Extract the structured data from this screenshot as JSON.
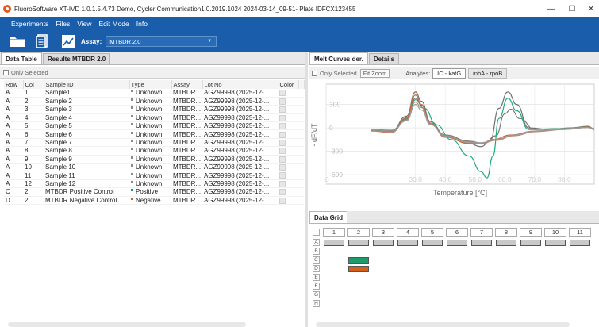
{
  "window": {
    "title": "FluoroSoftware XT-IVD 1.0.1.5.4.73 Demo, Cycler Communication1.0.2019.1024   2024-03-14_09-51- Plate IDFCX123455",
    "minimize": "—",
    "maximize": "☐",
    "close": "✕"
  },
  "menu": {
    "items": [
      "Experiments",
      "Files",
      "View",
      "Edit Mode",
      "Info"
    ]
  },
  "toolbar": {
    "assay_label": "Assay:",
    "assay_value": "MTBDR 2.0"
  },
  "left_panel": {
    "tabs": [
      "Data Table",
      "Results MTBDR 2.0"
    ],
    "only_selected": "Only Selected",
    "columns": [
      "Row",
      "Col",
      "Sample ID",
      "Type",
      "Assay",
      "Lot No",
      "Color",
      "I"
    ],
    "rows": [
      {
        "row": "A",
        "col": "1",
        "sample": "Sample1",
        "type": "Unknown",
        "assay": "MTBDR...",
        "lot": "AGZ99998  (2025-12-...",
        "marker": "#8a8a8a"
      },
      {
        "row": "A",
        "col": "2",
        "sample": "Sample 2",
        "type": "Unknown",
        "assay": "MTBDR...",
        "lot": "AGZ99998  (2025-12-...",
        "marker": "#8a8a8a"
      },
      {
        "row": "A",
        "col": "3",
        "sample": "Sample 3",
        "type": "Unknown",
        "assay": "MTBDR...",
        "lot": "AGZ99998  (2025-12-...",
        "marker": "#8a8a8a"
      },
      {
        "row": "A",
        "col": "4",
        "sample": "Sample 4",
        "type": "Unknown",
        "assay": "MTBDR...",
        "lot": "AGZ99998  (2025-12-...",
        "marker": "#8a8a8a"
      },
      {
        "row": "A",
        "col": "5",
        "sample": "Sample 5",
        "type": "Unknown",
        "assay": "MTBDR...",
        "lot": "AGZ99998  (2025-12-...",
        "marker": "#8a8a8a"
      },
      {
        "row": "A",
        "col": "6",
        "sample": "Sample 6",
        "type": "Unknown",
        "assay": "MTBDR...",
        "lot": "AGZ99998  (2025-12-...",
        "marker": "#8a8a8a"
      },
      {
        "row": "A",
        "col": "7",
        "sample": "Sample 7",
        "type": "Unknown",
        "assay": "MTBDR...",
        "lot": "AGZ99998  (2025-12-...",
        "marker": "#8a8a8a"
      },
      {
        "row": "A",
        "col": "8",
        "sample": "Sample 8",
        "type": "Unknown",
        "assay": "MTBDR...",
        "lot": "AGZ99998  (2025-12-...",
        "marker": "#8a8a8a"
      },
      {
        "row": "A",
        "col": "9",
        "sample": "Sample 9",
        "type": "Unknown",
        "assay": "MTBDR...",
        "lot": "AGZ99998  (2025-12-...",
        "marker": "#8a8a8a"
      },
      {
        "row": "A",
        "col": "10",
        "sample": "Sample 10",
        "type": "Unknown",
        "assay": "MTBDR...",
        "lot": "AGZ99998  (2025-12-...",
        "marker": "#8a8a8a"
      },
      {
        "row": "A",
        "col": "11",
        "sample": "Sample 11",
        "type": "Unknown",
        "assay": "MTBDR...",
        "lot": "AGZ99998  (2025-12-...",
        "marker": "#8a8a8a"
      },
      {
        "row": "A",
        "col": "12",
        "sample": "Sample 12",
        "type": "Unknown",
        "assay": "MTBDR...",
        "lot": "AGZ99998  (2025-12-...",
        "marker": "#8a8a8a"
      },
      {
        "row": "C",
        "col": "2",
        "sample": "MTBDR Positive Control",
        "type": "Positive",
        "assay": "MTBDR...",
        "lot": "AGZ99998  (2025-12-...",
        "marker": "#1f9a5a"
      },
      {
        "row": "D",
        "col": "2",
        "sample": "MTBDR Negative Control",
        "type": "Negative",
        "assay": "MTBDR...",
        "lot": "AGZ99998  (2025-12-...",
        "marker": "#d2601a"
      }
    ]
  },
  "right_panel": {
    "tabs": [
      "Melt Curves der.",
      "Details"
    ],
    "only_selected": "Only Selected",
    "fit_zoom": "Fit Zoom",
    "analytes_label": "Analytes:",
    "analytes": [
      "IC - katG",
      "inhA - rpoB"
    ]
  },
  "chart_data": {
    "type": "line",
    "xlabel": "Temperature [°C]",
    "ylabel": "- dF/dT",
    "xlim": [
      0,
      90
    ],
    "ylim": [
      -720,
      560
    ],
    "x_ticks": [
      0,
      30,
      40,
      50,
      60,
      70,
      80
    ],
    "x_tick_labels": [
      ".0",
      "30.0",
      "40.0",
      "50.0",
      "60.0",
      "70.0",
      "80.0"
    ],
    "y_ticks": [
      300,
      0,
      -300,
      -600
    ],
    "y_tick_labels": [
      "300",
      "0",
      "-300",
      "-600"
    ],
    "series": [
      {
        "color": "#6f6f6f",
        "points": [
          [
            15,
            -30
          ],
          [
            22,
            -40
          ],
          [
            27,
            150
          ],
          [
            30,
            460
          ],
          [
            32,
            340
          ],
          [
            35,
            80
          ],
          [
            40,
            -100
          ],
          [
            48,
            -200
          ],
          [
            52,
            -240
          ],
          [
            55,
            -170
          ],
          [
            58,
            250
          ],
          [
            61,
            460
          ],
          [
            64,
            300
          ],
          [
            68,
            0
          ],
          [
            75,
            -20
          ],
          [
            82,
            0
          ],
          [
            88,
            20
          ],
          [
            90,
            -20
          ]
        ]
      },
      {
        "color": "#7a7a7a",
        "points": [
          [
            15,
            -20
          ],
          [
            22,
            -30
          ],
          [
            27,
            120
          ],
          [
            30,
            380
          ],
          [
            32,
            290
          ],
          [
            35,
            60
          ],
          [
            40,
            -90
          ],
          [
            48,
            -170
          ],
          [
            53,
            -200
          ],
          [
            57,
            -100
          ],
          [
            60,
            180
          ],
          [
            62,
            240
          ],
          [
            65,
            120
          ],
          [
            70,
            -20
          ],
          [
            80,
            -10
          ],
          [
            88,
            15
          ],
          [
            90,
            -10
          ]
        ]
      },
      {
        "color": "#1faa83",
        "points": [
          [
            15,
            -30
          ],
          [
            22,
            -50
          ],
          [
            27,
            110
          ],
          [
            30,
            360
          ],
          [
            33,
            250
          ],
          [
            37,
            40
          ],
          [
            42,
            -150
          ],
          [
            48,
            -360
          ],
          [
            52,
            -560
          ],
          [
            54,
            -640
          ],
          [
            56,
            -360
          ],
          [
            58,
            120
          ],
          [
            61,
            380
          ],
          [
            64,
            220
          ],
          [
            68,
            -20
          ],
          [
            78,
            -10
          ],
          [
            88,
            10
          ],
          [
            90,
            -20
          ]
        ]
      },
      {
        "color": "#c76a3a",
        "points": [
          [
            15,
            -40
          ],
          [
            22,
            -60
          ],
          [
            27,
            130
          ],
          [
            30,
            420
          ],
          [
            32,
            300
          ],
          [
            35,
            60
          ],
          [
            40,
            -120
          ],
          [
            48,
            -200
          ],
          [
            52,
            -200
          ],
          [
            56,
            -150
          ],
          [
            62,
            -90
          ],
          [
            70,
            -40
          ],
          [
            80,
            -10
          ],
          [
            88,
            10
          ],
          [
            90,
            -15
          ]
        ]
      },
      {
        "color": "#b98b7a",
        "points": [
          [
            15,
            -35
          ],
          [
            22,
            -55
          ],
          [
            27,
            100
          ],
          [
            30,
            330
          ],
          [
            32,
            260
          ],
          [
            35,
            50
          ],
          [
            40,
            -110
          ],
          [
            48,
            -190
          ],
          [
            52,
            -200
          ],
          [
            57,
            -160
          ],
          [
            63,
            -100
          ],
          [
            70,
            -50
          ],
          [
            80,
            -20
          ],
          [
            88,
            5
          ],
          [
            90,
            -20
          ]
        ]
      },
      {
        "color": "#9a9a9a",
        "points": [
          [
            15,
            -20
          ],
          [
            22,
            -40
          ],
          [
            27,
            90
          ],
          [
            30,
            300
          ],
          [
            32,
            230
          ],
          [
            35,
            40
          ],
          [
            40,
            -100
          ],
          [
            48,
            -180
          ],
          [
            52,
            -190
          ],
          [
            57,
            -150
          ],
          [
            63,
            -90
          ],
          [
            70,
            -40
          ],
          [
            80,
            -10
          ],
          [
            88,
            5
          ],
          [
            90,
            -15
          ]
        ]
      }
    ]
  },
  "data_grid": {
    "tab": "Data Grid",
    "columns": [
      "1",
      "2",
      "3",
      "4",
      "5",
      "6",
      "7",
      "8",
      "9",
      "10",
      "11"
    ],
    "rows": [
      "A",
      "B",
      "C",
      "D",
      "E",
      "F",
      "G",
      "H"
    ],
    "wells": [
      {
        "row": 0,
        "col": 0,
        "color": "#c9c9c9"
      },
      {
        "row": 0,
        "col": 1,
        "color": "#c9c9c9"
      },
      {
        "row": 0,
        "col": 2,
        "color": "#c9c9c9"
      },
      {
        "row": 0,
        "col": 3,
        "color": "#c9c9c9"
      },
      {
        "row": 0,
        "col": 4,
        "color": "#c9c9c9"
      },
      {
        "row": 0,
        "col": 5,
        "color": "#c9c9c9"
      },
      {
        "row": 0,
        "col": 6,
        "color": "#c9c9c9"
      },
      {
        "row": 0,
        "col": 7,
        "color": "#c9c9c9"
      },
      {
        "row": 0,
        "col": 8,
        "color": "#c9c9c9"
      },
      {
        "row": 0,
        "col": 9,
        "color": "#c9c9c9"
      },
      {
        "row": 0,
        "col": 10,
        "color": "#c9c9c9"
      },
      {
        "row": 2,
        "col": 1,
        "color": "#1f9a6a"
      },
      {
        "row": 3,
        "col": 1,
        "color": "#d2601a"
      }
    ]
  },
  "colors": {
    "brand_blue": "#1a5dab",
    "positive": "#1f9a5a",
    "negative": "#d2601a"
  }
}
